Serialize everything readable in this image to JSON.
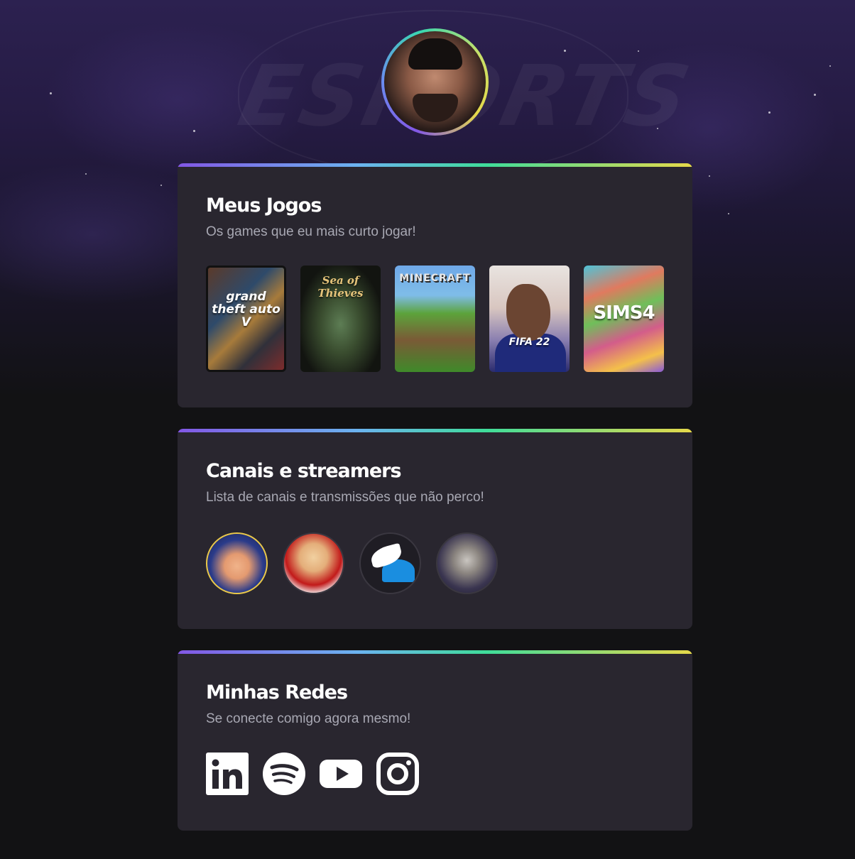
{
  "profile": {
    "avatar_icon": "user-avatar-photo"
  },
  "hero": {
    "watermark": "ESPORTS"
  },
  "games_card": {
    "title": "Meus Jogos",
    "subtitle": "Os games que eu mais curto jogar!",
    "games": [
      {
        "name": "grand theft auto V"
      },
      {
        "name": "Sea of Thieves"
      },
      {
        "name": "MINECRAFT"
      },
      {
        "name": "FIFA 22"
      },
      {
        "name": "SIMS4"
      }
    ]
  },
  "streamers_card": {
    "title": "Canais e streamers",
    "subtitle": "Lista de canais e transmissões que não perco!"
  },
  "socials_card": {
    "title": "Minhas Redes",
    "subtitle": "Se conecte comigo agora mesmo!",
    "networks": [
      {
        "icon": "linkedin-icon"
      },
      {
        "icon": "spotify-icon"
      },
      {
        "icon": "youtube-icon"
      },
      {
        "icon": "instagram-icon"
      }
    ]
  },
  "colors": {
    "background": "#121214",
    "card": "#29262f",
    "accent_start": "#8257e5",
    "accent_end": "#e6d94a",
    "text_muted": "#a8a8b3"
  }
}
